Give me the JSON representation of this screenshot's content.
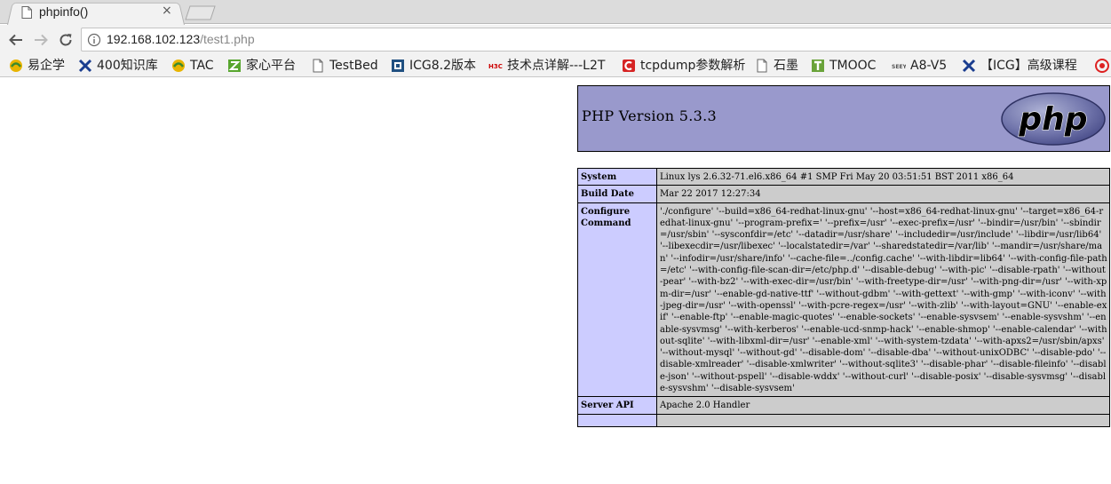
{
  "browser": {
    "tab": {
      "title": "phpinfo()",
      "close": "×"
    },
    "address": {
      "host": "192.168.102.123",
      "path": "/test1.php"
    },
    "bookmarks": [
      {
        "label": "易企学",
        "icon": "yiqixue-icon"
      },
      {
        "label": "400知识库",
        "icon": "h3c-x-icon"
      },
      {
        "label": "TAC",
        "icon": "yiqixue-icon"
      },
      {
        "label": "家心平台",
        "icon": "green-z-icon"
      },
      {
        "label": "TestBed",
        "icon": "page-icon"
      },
      {
        "label": "ICG8.2版本",
        "icon": "jira-icon"
      },
      {
        "label": "技术点详解---L2T",
        "icon": "h3c-icon"
      },
      {
        "label": "tcpdump参数解析",
        "icon": "red-c-icon"
      },
      {
        "label": "石墨",
        "icon": "page-icon"
      },
      {
        "label": "TMOOC",
        "icon": "tmooc-icon"
      },
      {
        "label": "A8-V5",
        "icon": "a8-icon"
      },
      {
        "label": "【ICG】高级课程",
        "icon": "h3c-x-icon"
      }
    ]
  },
  "phpinfo": {
    "version": "PHP Version 5.3.3",
    "logo_text": "php",
    "rows": [
      {
        "label": "System",
        "value": "Linux lys 2.6.32-71.el6.x86_64 #1 SMP Fri May 20 03:51:51 BST 2011 x86_64"
      },
      {
        "label": "Build Date",
        "value": "Mar 22 2017 12:27:34"
      },
      {
        "label": "Configure Command",
        "value": "'./configure' '--build=x86_64-redhat-linux-gnu' '--host=x86_64-redhat-linux-gnu' '--target=x86_64-redhat-linux-gnu' '--program-prefix=' '--prefix=/usr' '--exec-prefix=/usr' '--bindir=/usr/bin' '--sbindir=/usr/sbin' '--sysconfdir=/etc' '--datadir=/usr/share' '--includedir=/usr/include' '--libdir=/usr/lib64' '--libexecdir=/usr/libexec' '--localstatedir=/var' '--sharedstatedir=/var/lib' '--mandir=/usr/share/man' '--infodir=/usr/share/info' '--cache-file=../config.cache' '--with-libdir=lib64' '--with-config-file-path=/etc' '--with-config-file-scan-dir=/etc/php.d' '--disable-debug' '--with-pic' '--disable-rpath' '--without-pear' '--with-bz2' '--with-exec-dir=/usr/bin' '--with-freetype-dir=/usr' '--with-png-dir=/usr' '--with-xpm-dir=/usr' '--enable-gd-native-ttf' '--without-gdbm' '--with-gettext' '--with-gmp' '--with-iconv' '--with-jpeg-dir=/usr' '--with-openssl' '--with-pcre-regex=/usr' '--with-zlib' '--with-layout=GNU' '--enable-exif' '--enable-ftp' '--enable-magic-quotes' '--enable-sockets' '--enable-sysvsem' '--enable-sysvshm' '--enable-sysvmsg' '--with-kerberos' '--enable-ucd-snmp-hack' '--enable-shmop' '--enable-calendar' '--without-sqlite' '--with-libxml-dir=/usr' '--enable-xml' '--with-system-tzdata' '--with-apxs2=/usr/sbin/apxs' '--without-mysql' '--without-gd' '--disable-dom' '--disable-dba' '--without-unixODBC' '--disable-pdo' '--disable-xmlreader' '--disable-xmlwriter' '--without-sqlite3' '--disable-phar' '--disable-fileinfo' '--disable-json' '--without-pspell' '--disable-wddx' '--without-curl' '--disable-posix' '--disable-sysvmsg' '--disable-sysvshm' '--disable-sysvsem'"
      },
      {
        "label": "Server API",
        "value": "Apache 2.0 Handler"
      },
      {
        "label": "",
        "value": ""
      }
    ]
  }
}
